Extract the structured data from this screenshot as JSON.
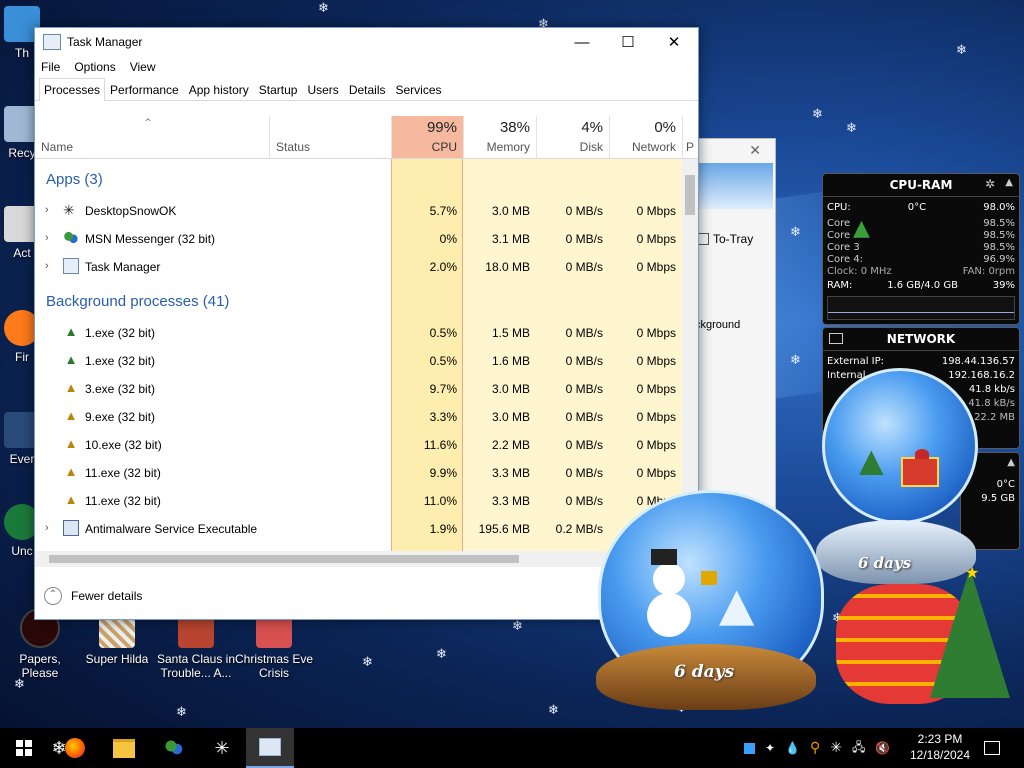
{
  "desktop_icons": [
    {
      "label": "Th",
      "partial": true
    },
    {
      "label": "Recy",
      "partial": true
    },
    {
      "label": "Act",
      "partial": true
    },
    {
      "label": "Fir",
      "partial": true
    },
    {
      "label": "Ever",
      "partial": true
    },
    {
      "label": "Unc",
      "partial": true
    },
    {
      "label": "Papers, Please"
    },
    {
      "label": "Super Hilda"
    },
    {
      "label": "Santa Claus in Trouble... A..."
    },
    {
      "label": "Christmas Eve Crisis"
    }
  ],
  "task_manager": {
    "title": "Task Manager",
    "menu": [
      "File",
      "Options",
      "View"
    ],
    "tabs": [
      "Processes",
      "Performance",
      "App history",
      "Startup",
      "Users",
      "Details",
      "Services"
    ],
    "active_tab": "Processes",
    "columns": {
      "name": "Name",
      "status": "Status",
      "cpu": {
        "pct": "99%",
        "label": "CPU"
      },
      "memory": {
        "pct": "38%",
        "label": "Memory"
      },
      "disk": {
        "pct": "4%",
        "label": "Disk"
      },
      "network": {
        "pct": "0%",
        "label": "Network"
      },
      "power": "P"
    },
    "groups": {
      "apps": "Apps (3)",
      "background": "Background processes (41)"
    },
    "apps": [
      {
        "name": "DesktopSnowOK",
        "cpu": "5.7%",
        "memory": "3.0 MB",
        "disk": "0 MB/s",
        "network": "0 Mbps"
      },
      {
        "name": "MSN Messenger (32 bit)",
        "cpu": "0%",
        "memory": "3.1 MB",
        "disk": "0 MB/s",
        "network": "0 Mbps"
      },
      {
        "name": "Task Manager",
        "cpu": "2.0%",
        "memory": "18.0 MB",
        "disk": "0 MB/s",
        "network": "0 Mbps"
      }
    ],
    "background": [
      {
        "name": "1.exe (32 bit)",
        "cpu": "0.5%",
        "memory": "1.5 MB",
        "disk": "0 MB/s",
        "network": "0 Mbps"
      },
      {
        "name": "1.exe (32 bit)",
        "cpu": "0.5%",
        "memory": "1.6 MB",
        "disk": "0 MB/s",
        "network": "0 Mbps"
      },
      {
        "name": "3.exe (32 bit)",
        "cpu": "9.7%",
        "memory": "3.0 MB",
        "disk": "0 MB/s",
        "network": "0 Mbps"
      },
      {
        "name": "9.exe (32 bit)",
        "cpu": "3.3%",
        "memory": "3.0 MB",
        "disk": "0 MB/s",
        "network": "0 Mbps"
      },
      {
        "name": "10.exe (32 bit)",
        "cpu": "11.6%",
        "memory": "2.2 MB",
        "disk": "0 MB/s",
        "network": "0 Mbps"
      },
      {
        "name": "11.exe (32 bit)",
        "cpu": "9.9%",
        "memory": "3.3 MB",
        "disk": "0 MB/s",
        "network": "0 Mbps"
      },
      {
        "name": "11.exe (32 bit)",
        "cpu": "11.0%",
        "memory": "3.3 MB",
        "disk": "0 MB/s",
        "network": "0 Mbps"
      },
      {
        "name": "Antimalware Service Executable",
        "cpu": "1.9%",
        "memory": "195.6 MB",
        "disk": "0.2 MB/s",
        "network": "0 Mbps"
      }
    ],
    "fewer_details": "Fewer details"
  },
  "back_window": {
    "to_tray": "To-Tray",
    "partial_text": "ckground"
  },
  "cpu_ram_gadget": {
    "title": "CPU-RAM",
    "cpu_label": "CPU:",
    "cpu_temp": "0°C",
    "cpu_total": "98.0%",
    "cores": [
      {
        "label": "Core",
        "value": "98.5%"
      },
      {
        "label": "Core",
        "value": "98.5%"
      },
      {
        "label": "Core 3",
        "value": "98.5%"
      },
      {
        "label": "Core 4:",
        "value": "96.9%"
      }
    ],
    "clock": "Clock: 0 MHz",
    "fan": "FAN: 0rpm",
    "ram_label": "RAM:",
    "ram_value": "1.6 GB/4.0 GB",
    "ram_pct": "39%"
  },
  "network_gadget": {
    "title": "NETWORK",
    "external_ip_label": "External IP:",
    "external_ip": "198.44.136.57",
    "internal_label": "Internal",
    "internal_ip": "192.168.16.2",
    "rate1": "41.8 kb/s",
    "rate2": "41.8 kB/s",
    "rate3": "22.2 MB"
  },
  "extra_gadget": {
    "temp": "0°C",
    "mem": "9.5 GB"
  },
  "globes": {
    "big_label": "6 days",
    "small_label": "6 days"
  },
  "taskbar": {
    "clock_time": "2:23 PM",
    "clock_date": "12/18/2024"
  }
}
